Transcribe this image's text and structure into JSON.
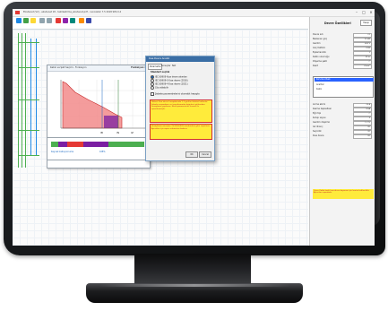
{
  "app": {
    "title": "Ekodenet (V2) - ekodenet 18 - tekillestirme_ekodenet.pdf - nuncaVelc 7.5 2018 SP2.0.4",
    "window_controls": [
      "–",
      "□",
      "×"
    ]
  },
  "chart_window": {
    "title": "Kablo ve Şalt Seçimi - Fonksiyon",
    "label": "Fonksiyon 1",
    "axis_labels": [
      "IB",
      "IN",
      "IZ"
    ],
    "lower_label": "Kaynak kalkış koruma",
    "lower_value": "108%"
  },
  "dialog": {
    "title": "Kısa Devre Analizi",
    "tabs": [
      "Parametre",
      "Sonuçlar",
      "Not"
    ],
    "heading": "Standart seçimi",
    "options": [
      {
        "label": "IEC 60909 Kısa devre akımları",
        "selected": true
      },
      {
        "label": "IEC 60909-0 Kısa devre (2016)",
        "selected": false
      },
      {
        "label": "IEC 60909-4 Kısa devre (2021)",
        "selected": false
      },
      {
        "label": "Göz atılabilir",
        "selected": false
      }
    ],
    "checkbox": "Şebeke parametrelerini otomatik hesapla",
    "warning_1": "Dikkat: Kısa devre hesaplarında 1.1 gerilim faktörü kullanılır. Şebeke empedansı ve transformatör değerleri girilmeden hesaplama yapılmaz. Eksik parametreler kırmızı ile işaretlenmiştir.",
    "warning_2": "Hesaplama sonuçları TS EN 60909 standardına göre raporlanır. Ayrıntılar için rapor sekmesine bakınız.",
    "ok": "OK",
    "cancel": "Cancel"
  },
  "panel": {
    "title": "Devre Özellikleri",
    "top_button": "Hesap",
    "fields": [
      {
        "label": "Devre adı",
        "value": "F1"
      },
      {
        "label": "Beslenen güç",
        "value": "12 kW"
      },
      {
        "label": "Gerilim",
        "value": "400 V"
      },
      {
        "label": "Güç faktörü",
        "value": "0.85"
      },
      {
        "label": "Eşzamanlılık",
        "value": "1"
      },
      {
        "label": "Kablo uzunluğu",
        "value": "35 m"
      },
      {
        "label": "Döşeme şekli",
        "value": "C"
      },
      {
        "label": "Kesit",
        "value": "4 mm²"
      }
    ],
    "list_items": [
      "Koruma cihazı",
      "Anahtar",
      "Kablo"
    ],
    "fields_2": [
      {
        "label": "Anma akımı",
        "value": "25 A"
      },
      {
        "label": "Kesme kapasitesi",
        "value": "6 kA"
      },
      {
        "label": "Eğri tipi",
        "value": "C"
      },
      {
        "label": "Kutup sayısı",
        "value": "3"
      },
      {
        "label": "Gerilim düşümü",
        "value": "1.2 %"
      },
      {
        "label": "Isıl direnç",
        "value": "OK"
      },
      {
        "label": "Seçicilik",
        "value": "OK"
      },
      {
        "label": "Kısa devre",
        "value": "OK"
      }
    ],
    "bottom_warning": "Uyarı: Kablo kesiti kısa devre dayanımı için kontrol edilmelidir. Ayrıntılar rapordadır."
  }
}
